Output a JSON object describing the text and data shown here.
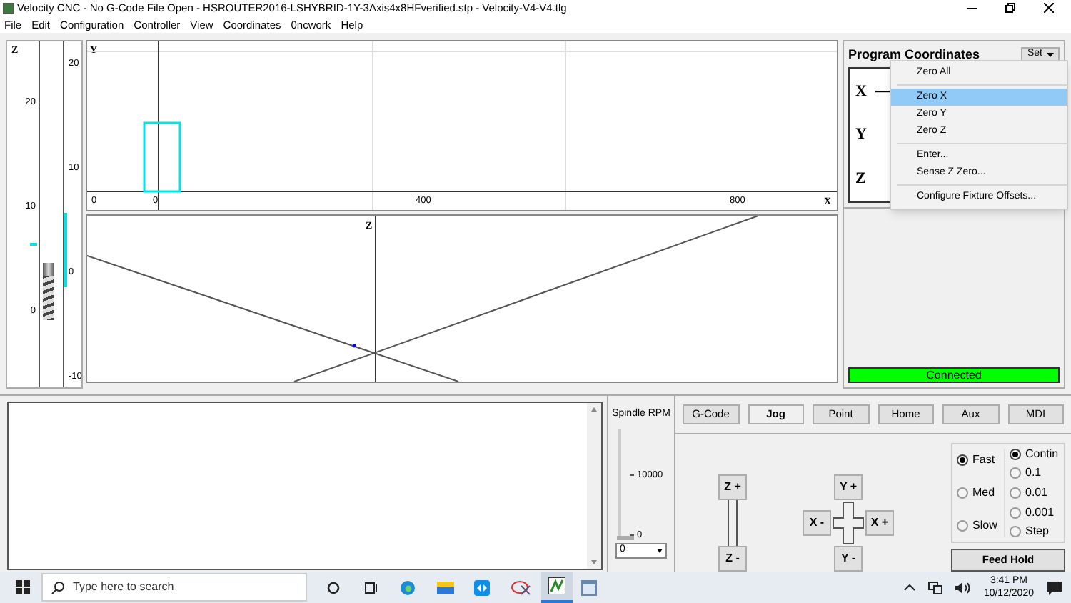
{
  "window": {
    "title": "Velocity CNC - No G-Code File Open - HSROUTER2016-LSHYBRID-1Y-3Axis4x8HFverified.stp - Velocity-V4-V4.tlg"
  },
  "menu": [
    "File",
    "Edit",
    "Configuration",
    "Controller",
    "View",
    "Coordinates",
    "0ncwork",
    "Help"
  ],
  "z_rulers": [
    {
      "label": "Z",
      "ticks": [
        "20",
        "10",
        "0"
      ]
    },
    {
      "ticks": [
        "20",
        "10",
        "0",
        "-10"
      ]
    }
  ],
  "top_view": {
    "axis_y": "Y",
    "axis_x": "X",
    "x_ticks": [
      "0",
      "0",
      "400",
      "800"
    ]
  },
  "side_view": {
    "axis": "Z"
  },
  "program_coordinates": {
    "title": "Program Coordinates",
    "set_button": "Set",
    "axes": [
      {
        "label": "X",
        "value": "—"
      },
      {
        "label": "Y"
      },
      {
        "label": "Z"
      }
    ]
  },
  "set_menu": [
    {
      "kind": "item",
      "label": "Zero All",
      "selected": false
    },
    {
      "kind": "separator"
    },
    {
      "kind": "item",
      "label": "Zero X",
      "selected": true
    },
    {
      "kind": "item",
      "label": "Zero Y",
      "selected": false
    },
    {
      "kind": "item",
      "label": "Zero Z",
      "selected": false
    },
    {
      "kind": "separator"
    },
    {
      "kind": "item",
      "label": "Enter...",
      "selected": false
    },
    {
      "kind": "item",
      "label": "Sense Z Zero...",
      "selected": false
    },
    {
      "kind": "separator"
    },
    {
      "kind": "item",
      "label": "Configure Fixture Offsets...",
      "selected": false
    }
  ],
  "status": {
    "text": "Connected"
  },
  "spindle": {
    "title": "Spindle RPM",
    "ticks": [
      "10000",
      "0"
    ],
    "level": 0,
    "value": "0"
  },
  "tabs": [
    {
      "label": "G-Code",
      "selected": false
    },
    {
      "label": "Jog",
      "selected": true
    },
    {
      "label": "Point",
      "selected": false
    },
    {
      "label": "Home",
      "selected": false
    },
    {
      "label": "Aux",
      "selected": false
    },
    {
      "label": "MDI",
      "selected": false
    }
  ],
  "jog_buttons": {
    "z_plus": "Z +",
    "z_minus": "Z -",
    "y_plus": "Y +",
    "x_minus": "X -",
    "x_plus": "X +",
    "y_minus": "Y -"
  },
  "speed": [
    {
      "label": "Fast",
      "selected": true
    },
    {
      "label": "Med",
      "selected": false
    },
    {
      "label": "Slow",
      "selected": false
    }
  ],
  "step": [
    {
      "label": "Contin",
      "selected": true
    },
    {
      "label": "0.1",
      "selected": false
    },
    {
      "label": "0.01",
      "selected": false
    },
    {
      "label": "0.001",
      "selected": false
    },
    {
      "label": "Step",
      "selected": false
    }
  ],
  "feed_hold": "Feed Hold",
  "taskbar": {
    "search_placeholder": "Type here to search",
    "time": "3:41 PM",
    "date": "10/12/2020"
  }
}
